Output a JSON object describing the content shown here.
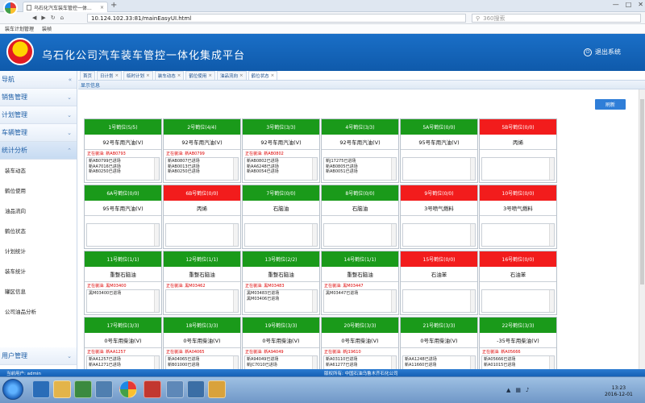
{
  "browser": {
    "tab_title": "乌石化汽车装车管控一体...",
    "address": "10.124.102.33:81/mainEasyUI.html",
    "search_placeholder": "360搜索",
    "favorites": [
      "装车计划管理",
      "装帧"
    ]
  },
  "app": {
    "title": "乌石化公司汽车装车管控一体化集成平台",
    "logout_label": "退出系统"
  },
  "sidebar": {
    "nav_label": "导航",
    "sections": [
      {
        "label": "销售管理"
      },
      {
        "label": "计划管理"
      },
      {
        "label": "车辆管理"
      },
      {
        "label": "统计分析"
      }
    ],
    "sub_items": [
      "装车动态",
      "鹤位使用",
      "油品流向",
      "鹤位状态",
      "计划统计",
      "装车统计",
      "罐区信息",
      "公司油品分析"
    ],
    "bottom_label": "用户管理"
  },
  "tabs": [
    "首页",
    "日计划",
    "临时计划",
    "装车动态",
    "鹤位使用",
    "油品流向",
    "鹤位状态"
  ],
  "panel_title": "显示信息",
  "refresh_label": "刷新",
  "cells": [
    {
      "title": "1号鹤位(5/5)",
      "status": "green",
      "product": "92号车用汽油(V)",
      "loading": "正在装油: 新AB0793",
      "rows": [
        "新AB0799已进场",
        "新AA7016已进场",
        "新AB0250已进场"
      ]
    },
    {
      "title": "2号鹤位(4/4)",
      "status": "green",
      "product": "92号车用汽油(V)",
      "loading": "正在装油: 新AB0799",
      "rows": [
        "新AB0807已进场",
        "新AB0013已进场",
        "新AB0250已进场"
      ]
    },
    {
      "title": "3号鹤位(3/3)",
      "status": "green",
      "product": "92号车用汽油(V)",
      "loading": "正在装油: 新AB0802",
      "rows": [
        "新AB0802已进场",
        "新AA6248已进场",
        "新AB0054已进场"
      ]
    },
    {
      "title": "4号鹤位(3/3)",
      "status": "green",
      "product": "92号车用汽油(V)",
      "loading": "",
      "rows": [
        "新J17275已进场",
        "新AB0805已进场",
        "新AB0051已进场"
      ]
    },
    {
      "title": "5A号鹤位(0/0)",
      "status": "green",
      "product": "95号车用汽油(V)",
      "loading": "",
      "rows": []
    },
    {
      "title": "5B号鹤位(0/0)",
      "status": "red",
      "product": "丙烯",
      "loading": "",
      "rows": []
    },
    {
      "title": "6A号鹤位(0/0)",
      "status": "green",
      "product": "95号车用汽油(V)",
      "loading": "",
      "rows": []
    },
    {
      "title": "6B号鹤位(0/0)",
      "status": "red",
      "product": "丙烯",
      "loading": "",
      "rows": []
    },
    {
      "title": "7号鹤位(0/0)",
      "status": "green",
      "product": "石脑油",
      "loading": "",
      "rows": []
    },
    {
      "title": "8号鹤位(0/0)",
      "status": "green",
      "product": "石脑油",
      "loading": "",
      "rows": []
    },
    {
      "title": "9号鹤位(0/0)",
      "status": "red",
      "product": "3号喷气燃料",
      "loading": "",
      "rows": []
    },
    {
      "title": "10号鹤位(0/0)",
      "status": "red",
      "product": "3号喷气燃料",
      "loading": "",
      "rows": []
    },
    {
      "title": "11号鹤位(1/1)",
      "status": "green",
      "product": "重整石脑油",
      "loading": "正在装油: 黑M03400",
      "rows": [
        "黑M03400已进场"
      ]
    },
    {
      "title": "12号鹤位(1/1)",
      "status": "green",
      "product": "重整石脑油",
      "loading": "正在装油: 黑M03462",
      "rows": []
    },
    {
      "title": "13号鹤位(2/2)",
      "status": "green",
      "product": "重整石脑油",
      "loading": "正在装油: 黑M03483",
      "rows": [
        "黑M03483已进场",
        "黑M03406已进场"
      ]
    },
    {
      "title": "14号鹤位(1/1)",
      "status": "green",
      "product": "重整石脑油",
      "loading": "正在装油: 黑M03447",
      "rows": [
        "黑M03447已进场"
      ]
    },
    {
      "title": "15号鹤位(0/0)",
      "status": "red",
      "product": "石油苯",
      "loading": "",
      "rows": []
    },
    {
      "title": "16号鹤位(0/0)",
      "status": "red",
      "product": "石油苯",
      "loading": "",
      "rows": []
    },
    {
      "title": "17号鹤位(3/3)",
      "status": "green",
      "product": "0号车用柴油(V)",
      "loading": "正在装油: 新AA1257",
      "rows": [
        "新AA1257已进场",
        "新AA1271已进场"
      ]
    },
    {
      "title": "18号鹤位(3/3)",
      "status": "green",
      "product": "0号车用柴油(V)",
      "loading": "正在装油: 新A04065",
      "rows": [
        "新A04065已进场",
        "新B01000已进场"
      ]
    },
    {
      "title": "19号鹤位(3/3)",
      "status": "green",
      "product": "0号车用柴油(V)",
      "loading": "正在装油: 新A94049",
      "rows": [
        "新A94049已进场",
        "新JC7010已进场"
      ]
    },
    {
      "title": "20号鹤位(3/3)",
      "status": "green",
      "product": "0号车用柴油(V)",
      "loading": "正在装油: 新J19610",
      "rows": [
        "新A03110已进场",
        "新A61277已进场"
      ]
    },
    {
      "title": "21号鹤位(3/3)",
      "status": "green",
      "product": "0号车用柴油(V)",
      "loading": "",
      "rows": [
        "新AA1248已进场",
        "新A11660已进场"
      ]
    },
    {
      "title": "22号鹤位(3/3)",
      "status": "green",
      "product": "-35号车用柴油(V)",
      "loading": "正在装油: 新A05666",
      "rows": [
        "新A05666已进场",
        "新A01015已进场"
      ]
    }
  ],
  "status_bar": {
    "user": "当前用户: admin",
    "copyright": "版权所有: 中国石油乌鲁木齐石化公司"
  },
  "clock": {
    "time": "13:23",
    "date": "2016-12-01"
  }
}
